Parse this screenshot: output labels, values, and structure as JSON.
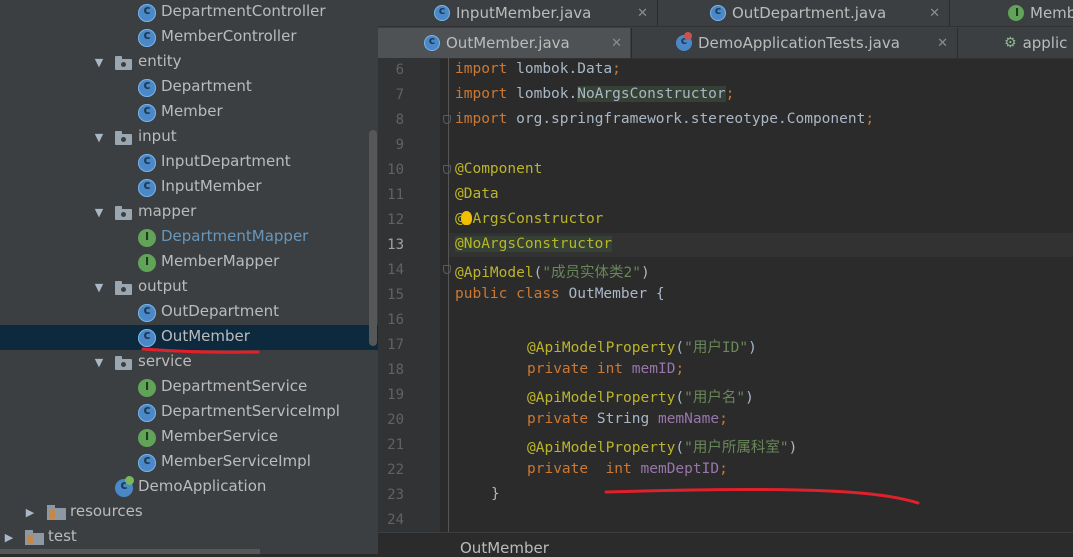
{
  "tree": {
    "items": [
      {
        "label": "DepartmentController",
        "icon": "class-icon",
        "level": 2
      },
      {
        "label": "MemberController",
        "icon": "class-icon",
        "level": 2
      },
      {
        "label": "entity",
        "icon": "package-icon",
        "level": 1,
        "expanded": true
      },
      {
        "label": "Department",
        "icon": "class-icon",
        "level": 2
      },
      {
        "label": "Member",
        "icon": "class-icon",
        "level": 2
      },
      {
        "label": "input",
        "icon": "package-icon",
        "level": 1,
        "expanded": true
      },
      {
        "label": "InputDepartment",
        "icon": "class-icon",
        "level": 2
      },
      {
        "label": "InputMember",
        "icon": "class-icon",
        "level": 2
      },
      {
        "label": "mapper",
        "icon": "package-icon",
        "level": 1,
        "expanded": true
      },
      {
        "label": "DepartmentMapper",
        "icon": "interface-icon",
        "level": 2
      },
      {
        "label": "MemberMapper",
        "icon": "interface-icon",
        "level": 2
      },
      {
        "label": "output",
        "icon": "package-icon",
        "level": 1,
        "expanded": true
      },
      {
        "label": "OutDepartment",
        "icon": "class-icon",
        "level": 2
      },
      {
        "label": "OutMember",
        "icon": "class-icon",
        "level": 2,
        "selected": true
      },
      {
        "label": "service",
        "icon": "package-icon",
        "level": 1,
        "expanded": true
      },
      {
        "label": "DepartmentService",
        "icon": "interface-icon",
        "level": 2
      },
      {
        "label": "DepartmentServiceImpl",
        "icon": "class-icon",
        "level": 2
      },
      {
        "label": "MemberService",
        "icon": "interface-icon",
        "level": 2
      },
      {
        "label": "MemberServiceImpl",
        "icon": "class-icon",
        "level": 2
      },
      {
        "label": "DemoApplication",
        "icon": "spring-app-icon",
        "level": 1
      },
      {
        "label": "resources",
        "icon": "folder-icon",
        "level": 0,
        "expanded": false
      },
      {
        "label": "test",
        "icon": "folder-icon",
        "level": -1,
        "expanded": false
      }
    ]
  },
  "tabs": {
    "row1": [
      {
        "label": "InputMember.java",
        "icon": "class-icon"
      },
      {
        "label": "OutDepartment.java",
        "icon": "class-icon"
      },
      {
        "label": "Member",
        "icon": "interface-icon"
      }
    ],
    "row2": [
      {
        "label": "OutMember.java",
        "icon": "class-icon",
        "active": true
      },
      {
        "label": "DemoApplicationTests.java",
        "icon": "test-class-icon"
      },
      {
        "label": "applic",
        "icon": "config-icon"
      }
    ]
  },
  "editor": {
    "line_numbers": [
      "6",
      "7",
      "8",
      "9",
      "10",
      "11",
      "12",
      "13",
      "14",
      "15",
      "16",
      "17",
      "18",
      "19",
      "20",
      "21",
      "22",
      "23",
      "24"
    ],
    "current_line": "13",
    "code": {
      "l6": {
        "kw": "import",
        "pkg": "lombok.",
        "cls": "Data",
        "end": ";"
      },
      "l7": {
        "kw": "import",
        "pkg": "lombok.",
        "cls": "NoArgsConstructor",
        "end": ";"
      },
      "l8": {
        "kw": "import",
        "pkg": "org.springframework.stereotype.",
        "cls": "Component",
        "end": ";"
      },
      "l10": "@Component",
      "l11": "@Data",
      "l12": {
        "a": "@",
        "b": "lArgsConstructor"
      },
      "l13": "@NoArgsConstructor",
      "l14": {
        "ann": "@ApiModel",
        "open": "(",
        "str": "\"成员实体类2\"",
        "close": ")"
      },
      "l15": {
        "kw1": "public",
        "kw2": "class",
        "name": "OutMember",
        "brace": "{"
      },
      "l17": {
        "ann": "@ApiModelProperty",
        "open": "(",
        "str": "\"用户ID\"",
        "close": ")"
      },
      "l18": {
        "kw1": "private",
        "kw2": "int",
        "field": "memID",
        "end": ";"
      },
      "l19": {
        "ann": "@ApiModelProperty",
        "open": "(",
        "str": "\"用户名\"",
        "close": ")"
      },
      "l20": {
        "kw1": "private",
        "type": "String",
        "field": "memName",
        "end": ";"
      },
      "l21": {
        "ann": "@ApiModelProperty",
        "open": "(",
        "str": "\"用户所属科室\"",
        "close": ")"
      },
      "l22": {
        "kw1": "private",
        "kw2": "int",
        "field": "memDeptID",
        "end": ";"
      },
      "l23": "}"
    },
    "breadcrumb": "OutMember"
  },
  "colors": {
    "keyword": "#cc7832",
    "annotation": "#bbb529",
    "string": "#6a8759",
    "field": "#9876aa",
    "text": "#a9b7c6",
    "selection": "#0d293e",
    "red_underline": "#e0202a"
  }
}
